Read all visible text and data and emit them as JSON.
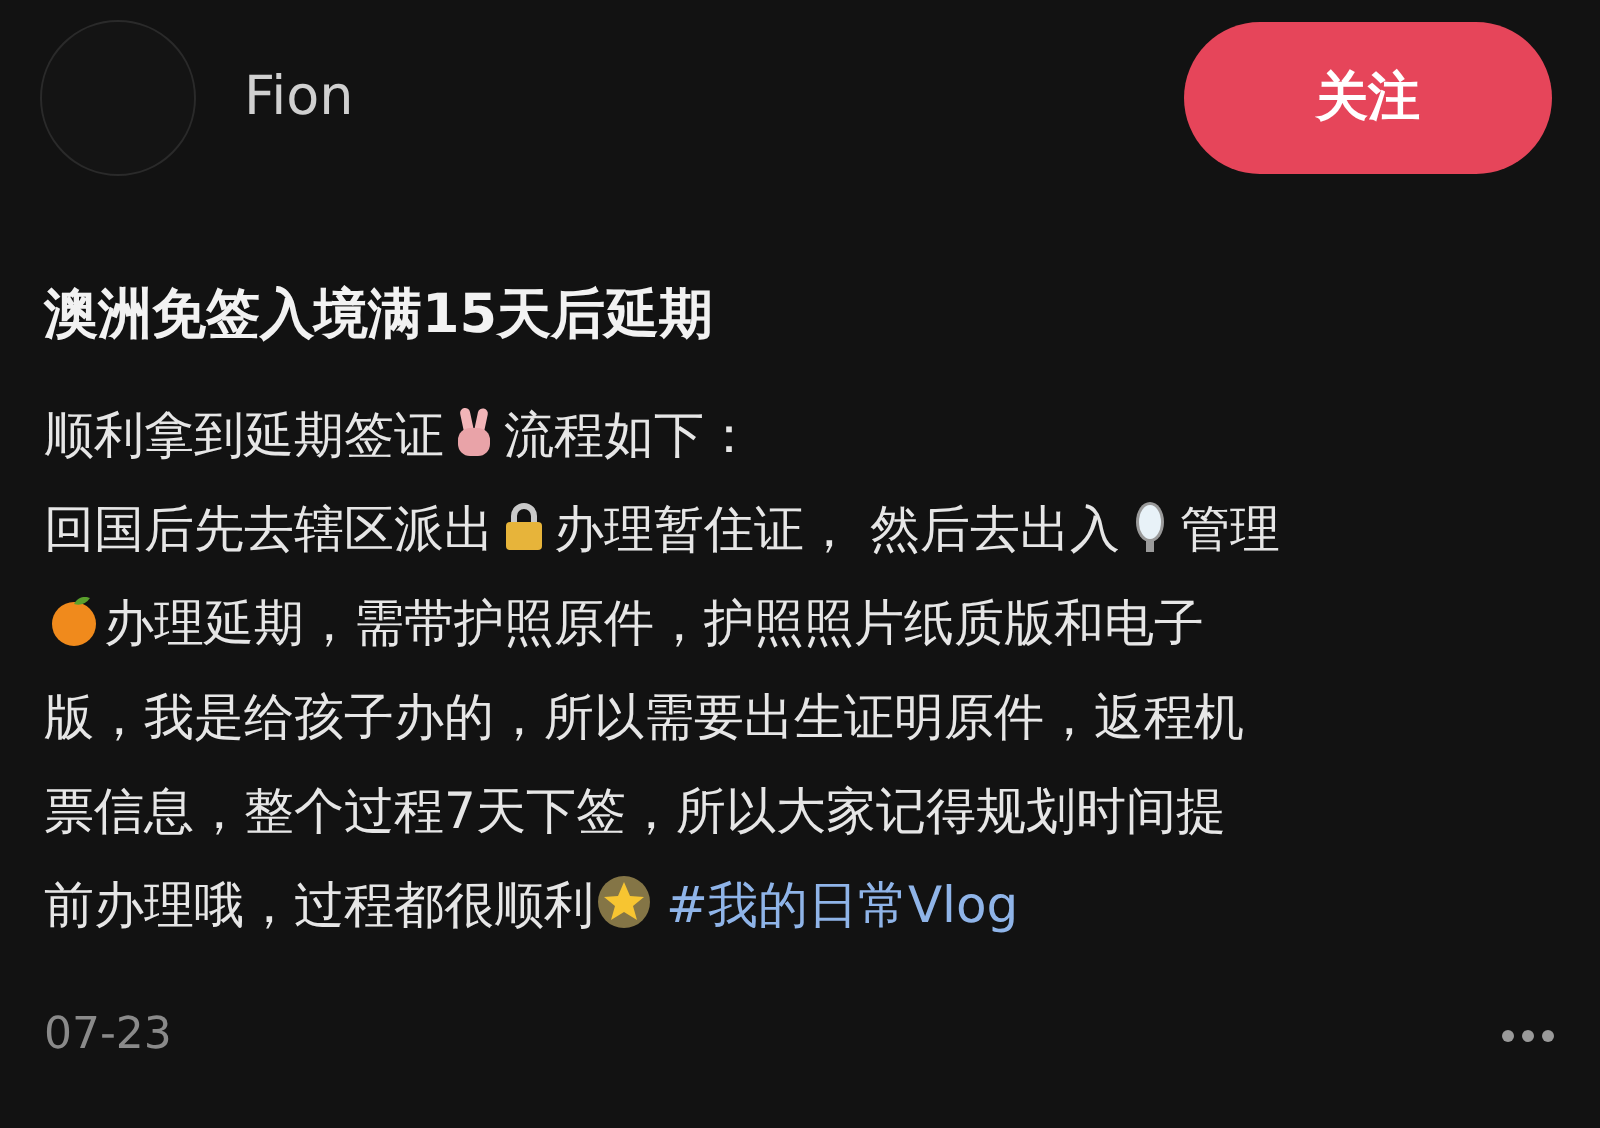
{
  "author": {
    "name": "Fion"
  },
  "follow_button": {
    "label": "关注"
  },
  "post": {
    "title": "澳洲免签入境满15天后延期",
    "paragraphs": [
      [
        {
          "kind": "text",
          "text": "顺利拿到延期签证"
        },
        {
          "kind": "victory-hand"
        },
        {
          "kind": "text",
          "text": "流程如下："
        }
      ],
      [
        {
          "kind": "text",
          "text": "回国后先去辖区派出"
        },
        {
          "kind": "lock"
        },
        {
          "kind": "text",
          "text": "办理暂住证， 然后去出入"
        },
        {
          "kind": "mirror"
        },
        {
          "kind": "text",
          "text": "管理"
        }
      ],
      [
        {
          "kind": "tangerine"
        },
        {
          "kind": "text",
          "text": "办理延期，需带护照原件，护照照片纸质版和电子"
        }
      ],
      [
        {
          "kind": "text",
          "text": "版，我是给孩子办的，所以需要出生证明原件，返程机"
        }
      ],
      [
        {
          "kind": "text",
          "text": "票信息，整个过程7天下签，所以大家记得规划时间提"
        }
      ],
      [
        {
          "kind": "text",
          "text": "前办理哦，过程都很顺利"
        },
        {
          "kind": "star"
        },
        {
          "kind": "hashtag",
          "text": "#我的日常Vlog"
        }
      ]
    ],
    "date": "07-23"
  }
}
